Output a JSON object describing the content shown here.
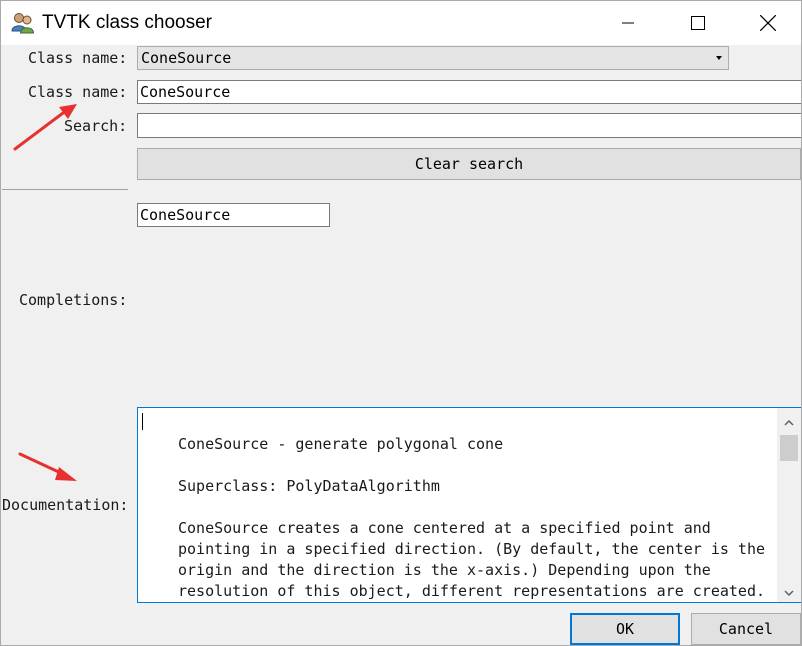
{
  "window": {
    "title": "TVTK class chooser"
  },
  "form": {
    "class_name_combo_label": "Class name:",
    "class_name_combo_value": "ConeSource",
    "class_name_input_label": "Class name:",
    "class_name_input_value": "ConeSource",
    "search_label": "Search:",
    "search_value": "",
    "clear_search_label": "Clear search",
    "completions_label": "Completions:",
    "completions_items": [
      "ConeSource"
    ],
    "documentation_label": "Documentation:"
  },
  "documentation": {
    "lines": [
      "ConeSource - generate polygonal cone",
      "",
      "Superclass: PolyDataAlgorithm",
      "",
      "ConeSource creates a cone centered at a specified point and",
      "pointing in a specified direction. (By default, the center is the",
      "origin and the direction is the x-axis.) Depending upon the",
      "resolution of this object, different representations are created."
    ]
  },
  "buttons": {
    "ok_label": "OK",
    "cancel_label": "Cancel"
  },
  "icons": {
    "app": "users-app-icon",
    "minimize": "minimize-icon",
    "maximize": "maximize-icon",
    "close": "close-icon",
    "dropdown": "chevron-down-icon",
    "scroll_up": "chevron-up-icon",
    "scroll_down": "chevron-down-icon",
    "annotation": "red-arrow-icon"
  },
  "colors": {
    "focus_accent": "#0078d7",
    "annotation_red": "#e8312f",
    "window_bg": "#f0f0f0"
  }
}
